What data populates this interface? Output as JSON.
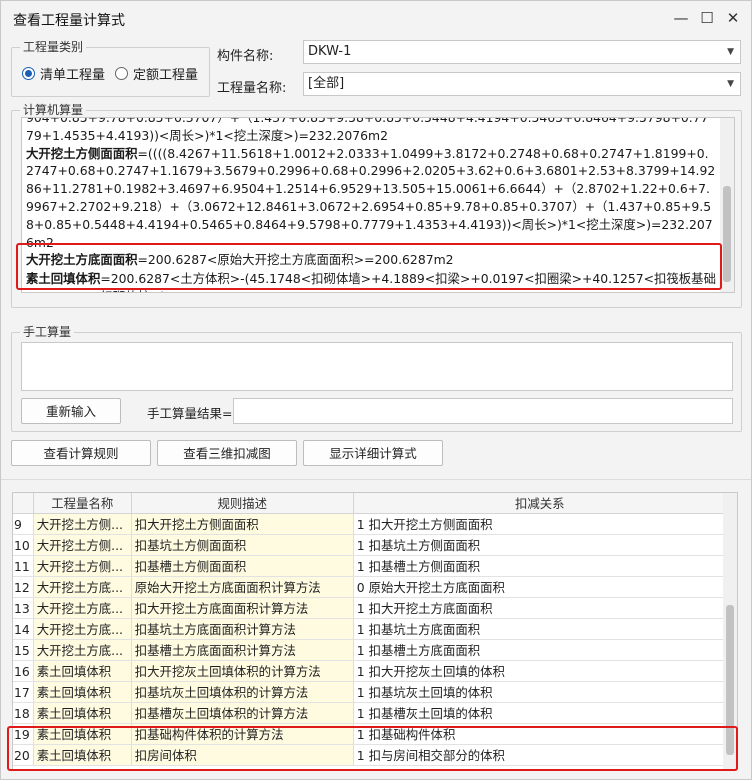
{
  "window": {
    "title": "查看工程量计算式"
  },
  "quantity_type": {
    "legend": "工程量类别",
    "options": [
      {
        "label": "清单工程量",
        "selected": true
      },
      {
        "label": "定额工程量",
        "selected": false
      }
    ]
  },
  "component": {
    "label": "构件名称:",
    "value": "DKW-1"
  },
  "quantity_name": {
    "label": "工程量名称:",
    "value": "[全部]"
  },
  "computer_calc": {
    "legend": "计算机算量",
    "lines": [
      {
        "bold": "",
        "text": "904+0.85+9.78+0.85+0.3707）+（1.437+0.85+9.58+0.85+0.5448+4.4194+0.5465+0.8464+9.5798+0.7779+1.4535+4.4193))<周长>)*1<挖土深度>)=232.2076m2"
      },
      {
        "bold": "大开挖土方侧面面积",
        "text": "=((((8.4267+11.5618+1.0012+2.0333+1.0499+3.8172+0.2748+0.68+0.2747+1.8199+0.2747+0.68+0.2747+1.1679+3.5679+0.2996+0.68+0.2996+2.0205+3.62+0.6+3.6801+2.53+8.3799+14.9286+11.2781+0.1982+3.4697+6.9504+1.2514+6.9529+13.505+15.0061+6.6644）+（2.8702+1.22+0.6+7.9967+2.2702+9.218）+（3.0672+12.8461+3.0672+2.6954+0.85+9.78+0.85+0.3707）+（1.437+0.85+9.58+0.85+0.5448+4.4194+0.5465+0.8464+9.5798+0.7779+1.4353+4.4193))<周长>)*1<挖土深度>)=232.2076m2"
      },
      {
        "bold": "大开挖土方底面面积",
        "text": "=200.6287<原始大开挖土方底面面积>=200.6287m2"
      },
      {
        "bold": "素土回填体积",
        "text": "=200.6287<土方体积>-(45.1748<扣砌体墙>+4.1889<扣梁>+0.0197<扣圈梁>+40.1257<扣筏板基础>+2.7521<扣砌体柱>)=108.3675m3"
      }
    ]
  },
  "manual_calc": {
    "legend": "手工算量",
    "reenter_button": "重新输入",
    "result_label": "手工算量结果=",
    "result_value": ""
  },
  "actions": {
    "view_rules": "查看计算规则",
    "view_3d": "查看三维扣减图",
    "show_details": "显示详细计算式"
  },
  "table": {
    "columns": [
      "工程量名称",
      "规则描述",
      "扣减关系"
    ],
    "rows": [
      {
        "no": "9",
        "name": "大开挖土方侧...",
        "rule": "扣大开挖土方侧面面积",
        "relation": "1 扣大开挖土方侧面面积"
      },
      {
        "no": "10",
        "name": "大开挖土方侧...",
        "rule": "扣基坑土方侧面面积",
        "relation": "1 扣基坑土方侧面面积"
      },
      {
        "no": "11",
        "name": "大开挖土方侧...",
        "rule": "扣基槽土方侧面面积",
        "relation": "1 扣基槽土方侧面面积"
      },
      {
        "no": "12",
        "name": "大开挖土方底...",
        "rule": "原始大开挖土方底面面积计算方法",
        "relation": "0 原始大开挖土方底面面积"
      },
      {
        "no": "13",
        "name": "大开挖土方底...",
        "rule": "扣大开挖土方底面面积计算方法",
        "relation": "1 扣大开挖土方底面面积"
      },
      {
        "no": "14",
        "name": "大开挖土方底...",
        "rule": "扣基坑土方底面面积计算方法",
        "relation": "1 扣基坑土方底面面积"
      },
      {
        "no": "15",
        "name": "大开挖土方底...",
        "rule": "扣基槽土方底面面积计算方法",
        "relation": "1 扣基槽土方底面面积"
      },
      {
        "no": "16",
        "name": "素土回填体积",
        "rule": "扣大开挖灰土回填体积的计算方法",
        "relation": "1 扣大开挖灰土回填的体积"
      },
      {
        "no": "17",
        "name": "素土回填体积",
        "rule": "扣基坑灰土回填体积的计算方法",
        "relation": "1 扣基坑灰土回填的体积"
      },
      {
        "no": "18",
        "name": "素土回填体积",
        "rule": "扣基槽灰土回填体积的计算方法",
        "relation": "1 扣基槽灰土回填的体积"
      },
      {
        "no": "19",
        "name": "素土回填体积",
        "rule": "扣基础构件体积的计算方法",
        "relation": "1 扣基础构件体积"
      },
      {
        "no": "20",
        "name": "素土回填体积",
        "rule": "扣房间体积",
        "relation": "1 扣与房间相交部分的体积"
      }
    ]
  },
  "colors": {
    "highlight": "#e01919",
    "row_yellow": "#fffbe1",
    "radio_accent": "#1a5fb4"
  }
}
